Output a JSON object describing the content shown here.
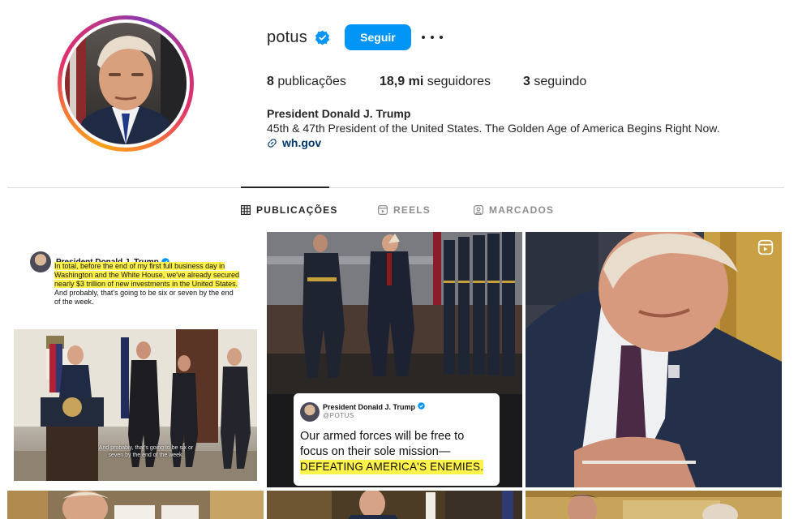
{
  "profile": {
    "username": "potus",
    "follow_label": "Seguir",
    "stats": {
      "posts_count": "8",
      "posts_label": "publicações",
      "followers_count": "18,9 mi",
      "followers_label": "seguidores",
      "following_count": "3",
      "following_label": "seguindo"
    },
    "full_name": "President Donald J. Trump",
    "bio": "45th & 47th President of the United States. The Golden Age of America Begins Right Now.",
    "link": "wh.gov"
  },
  "tabs": [
    {
      "label": "PUBLICAÇÕES",
      "icon": "grid-icon",
      "active": true
    },
    {
      "label": "REELS",
      "icon": "reels-icon",
      "active": false
    },
    {
      "label": "MARCADOS",
      "icon": "tagged-icon",
      "active": false
    }
  ],
  "posts": {
    "post1": {
      "tweet_name": "President Donald J. Trump",
      "tweet_highlight": "In total, before the end of my first full business day in Washington and the White House, we've already secured nearly $3 trillion of new investments in the United States.",
      "tweet_rest": " And probably, that's going to be six or seven by the end of the week.",
      "video_caption": "And probably, that's going to be six or seven by the end of the week."
    },
    "post2": {
      "card_name": "President Donald J. Trump",
      "card_handle": "@POTUS",
      "card_text": "Our armed forces will be free to focus on their sole mission—",
      "card_highlight": "DEFEATING AMERICA'S ENEMIES."
    },
    "post3": {
      "type_icon": "reel-icon"
    }
  },
  "colors": {
    "accent": "#0095f6",
    "link": "#00376b",
    "text": "#262626",
    "muted": "#8e8e8e",
    "verified": "#0095f6",
    "highlight": "#fff24a"
  }
}
